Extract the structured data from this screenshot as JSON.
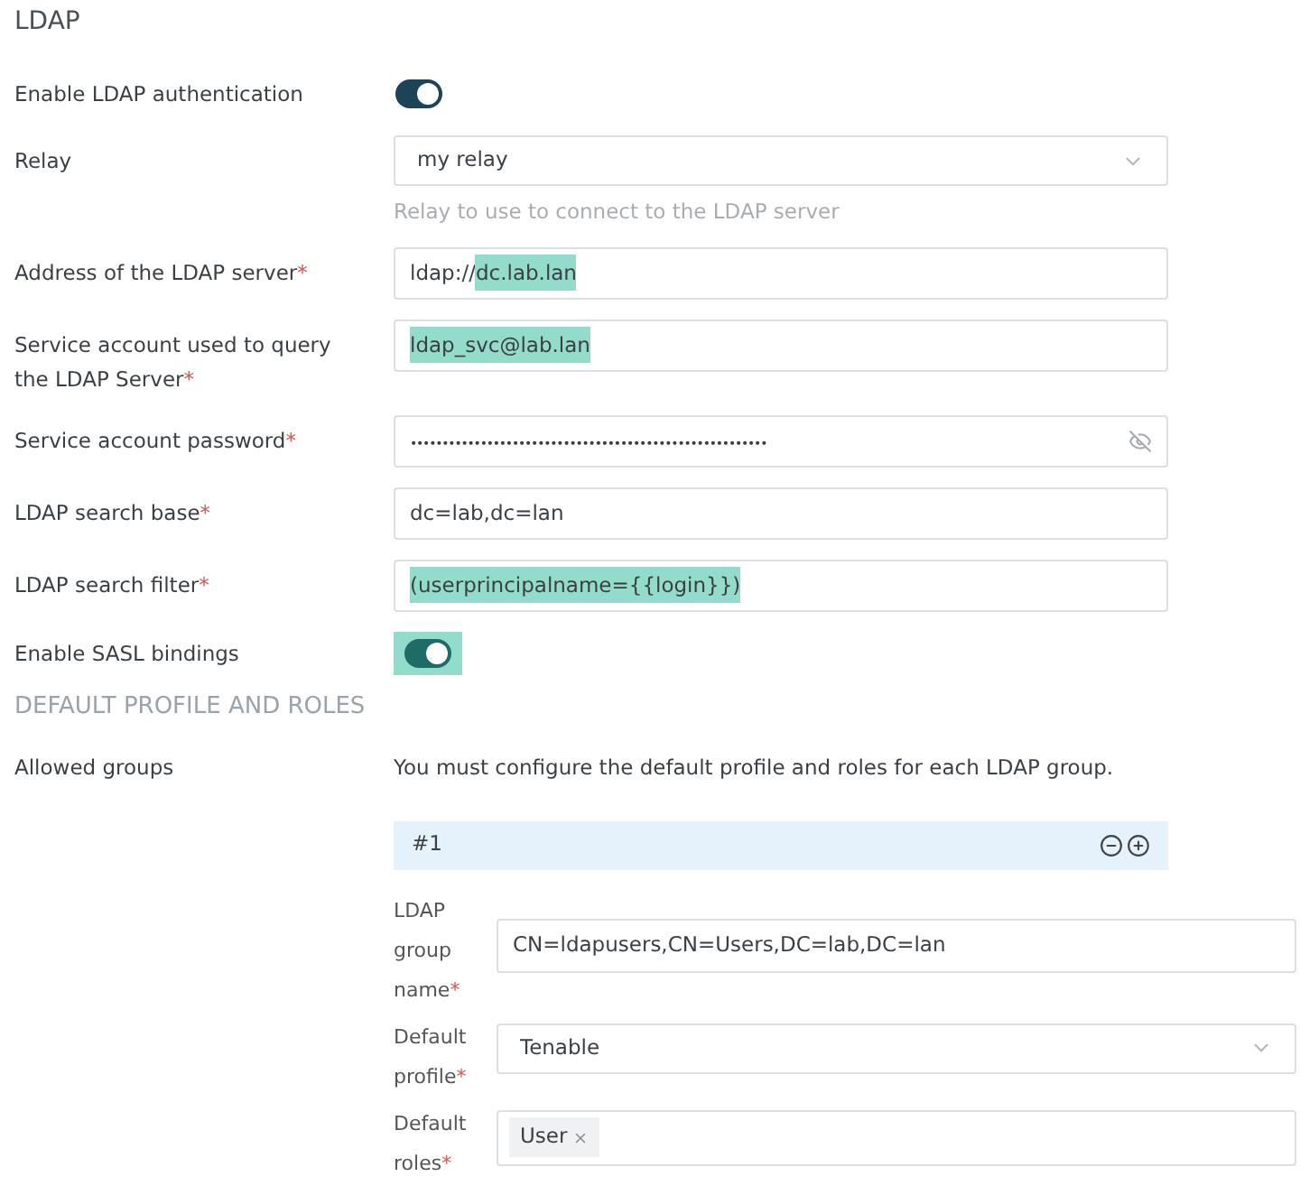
{
  "title": "LDAP",
  "settings": [
    {
      "kind": "toggle",
      "label": "Enable LDAP authentication",
      "on": true
    },
    {
      "kind": "select",
      "label": "Relay",
      "value": [
        {
          "text": "my relay",
          "highlighted": false
        }
      ],
      "hint": "Relay to use to connect to the LDAP server"
    },
    {
      "kind": "text",
      "label": "Address of the LDAP server",
      "mark": "*",
      "value": [
        {
          "text": "ldap://",
          "highlighted": false
        },
        {
          "text": "dc.lab.lan",
          "highlighted": true
        }
      ]
    },
    {
      "kind": "text",
      "label": "Service account used to query the LDAP Server",
      "mark": "*",
      "value": [
        {
          "text": "ldap_svc@lab.lan",
          "highlighted": true
        }
      ]
    },
    {
      "kind": "password",
      "label": "Service account password",
      "mark": "*",
      "value": [
        {
          "text": "••••••••••••••••••••••••••••••••••••••••••••••••••••••••",
          "highlighted": false
        }
      ]
    },
    {
      "kind": "text",
      "label": "LDAP search base",
      "mark": "*",
      "value": [
        {
          "text": "dc=lab,dc=lan",
          "highlighted": false
        }
      ]
    },
    {
      "kind": "text",
      "label": "LDAP search filter",
      "mark": "*",
      "value": [
        {
          "text": "(userprincipalname={{login}})",
          "highlighted": true
        }
      ]
    },
    {
      "kind": "toggle",
      "label": "Enable SASL bindings",
      "on": true,
      "highlighted": true
    }
  ],
  "section": {
    "heading": "DEFAULT PROFILE AND ROLES",
    "label": "Allowed groups",
    "note": "You must configure the default profile and roles for each LDAP group.",
    "groups": [
      {
        "number": "#1",
        "fields": [
          {
            "kind": "text",
            "label": "LDAP group name",
            "mark": "*",
            "value": "CN=ldapusers,CN=Users,DC=lab,DC=lan"
          },
          {
            "kind": "select",
            "label": "Default profile",
            "mark": "*",
            "value": "Tenable"
          },
          {
            "kind": "tags",
            "label": "Default roles",
            "mark": "*",
            "tags": [
              "User"
            ]
          }
        ]
      }
    ]
  }
}
